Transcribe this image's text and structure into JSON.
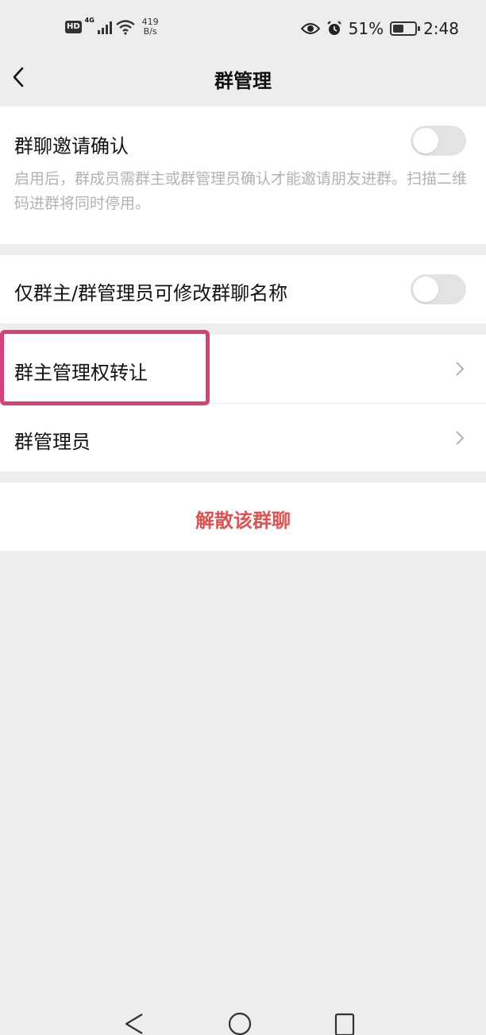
{
  "status_bar": {
    "hd": "HD",
    "network": "4G",
    "speed_value": "419",
    "speed_unit": "B/s",
    "battery": "51%",
    "time": "2:48",
    "battery_level": 0.51
  },
  "nav": {
    "title": "群管理",
    "back_icon": "chevron-left-icon"
  },
  "settings": {
    "invite_confirm": {
      "label": "群聊邀请确认",
      "description": "启用后，群成员需群主或群管理员确认才能邀请朋友进群。扫描二维码进群将同时停用。",
      "enabled": false
    },
    "rename_restrict": {
      "label": "仅群主/群管理员可修改群聊名称",
      "enabled": false
    },
    "transfer_owner": {
      "label": "群主管理权转让"
    },
    "admins": {
      "label": "群管理员"
    },
    "dismiss": {
      "label": "解散该群聊"
    }
  },
  "colors": {
    "highlight": "#d9407a",
    "danger": "#e05252",
    "background": "#ededed"
  }
}
